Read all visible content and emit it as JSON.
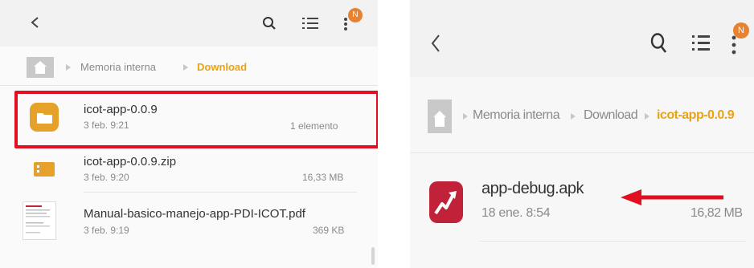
{
  "left": {
    "header": {
      "badge": "N"
    },
    "breadcrumb": {
      "item1": "Memoria interna",
      "item2": "Download"
    },
    "files": [
      {
        "name": "icot-app-0.0.9",
        "date": "3 feb. 9:21",
        "meta": "1 elemento"
      },
      {
        "name": "icot-app-0.0.9.zip",
        "date": "3 feb. 9:20",
        "meta": "16,33 MB"
      },
      {
        "name": "Manual-basico-manejo-app-PDI-ICOT.pdf",
        "date": "3 feb. 9:19",
        "meta": "369 KB"
      }
    ]
  },
  "right": {
    "header": {
      "badge": "N"
    },
    "breadcrumb": {
      "item1": "Memoria interna",
      "item2": "Download",
      "item3": "icot-app-0.0.9"
    },
    "file": {
      "name": "app-debug.apk",
      "date": "18 ene. 8:54",
      "meta": "16,82 MB"
    }
  },
  "colors": {
    "accent": "#e8a317",
    "highlight": "#e01020",
    "apk_icon": "#c0223a",
    "folder": "#e6a12a"
  }
}
